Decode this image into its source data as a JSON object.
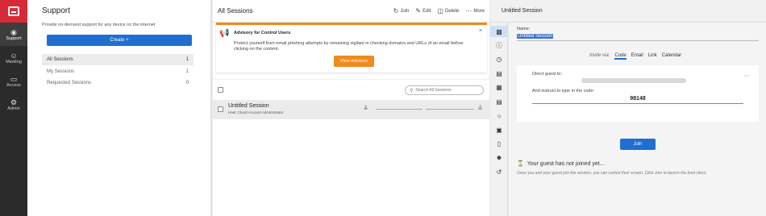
{
  "rail": {
    "items": [
      {
        "label": "Support",
        "icon": "headset-icon"
      },
      {
        "label": "Meeting",
        "icon": "people-icon"
      },
      {
        "label": "Access",
        "icon": "monitor-icon"
      },
      {
        "label": "Admin",
        "icon": "gear-icon"
      }
    ],
    "brand_color": "#d62b36"
  },
  "support": {
    "title": "Support",
    "description": "Provide on-demand support for any device on the internet",
    "create_label": "Create +",
    "nav": [
      {
        "label": "All Sessions",
        "count": "1"
      },
      {
        "label": "My Sessions",
        "count": "1"
      },
      {
        "label": "Requested Sessions",
        "count": "0"
      }
    ]
  },
  "sessions": {
    "title": "All Sessions",
    "actions": {
      "join": "Join",
      "edit": "Edit",
      "delete": "Delete",
      "more": "More"
    },
    "advisory": {
      "title": "Advisory for Control Users",
      "text": "Protect yourself from email phishing attempts by remaining vigilant in checking domains and URLs of an email before clicking on the content.",
      "button": "View Advisory",
      "close": "×"
    },
    "search_placeholder": "Search All Sessions",
    "rows": [
      {
        "name": "Untitled Session",
        "host": "Host: Cloud Account Administrator"
      }
    ]
  },
  "detail": {
    "title": "Untitled Session",
    "name_label": "Name:",
    "name_value": "Untitled Session",
    "invite_via": "Invite via:",
    "invite_tabs": [
      "Code",
      "Email",
      "Link",
      "Calendar"
    ],
    "direct_label": "Direct guest to:",
    "instruct_label": "And instruct to type in the code:",
    "code": "98148",
    "join_label": "Join",
    "wait_title": "Your guest has not joined yet...",
    "wait_sub": "Once you and your guest join the session, you can control their screen. Click Join to launch the host client."
  }
}
